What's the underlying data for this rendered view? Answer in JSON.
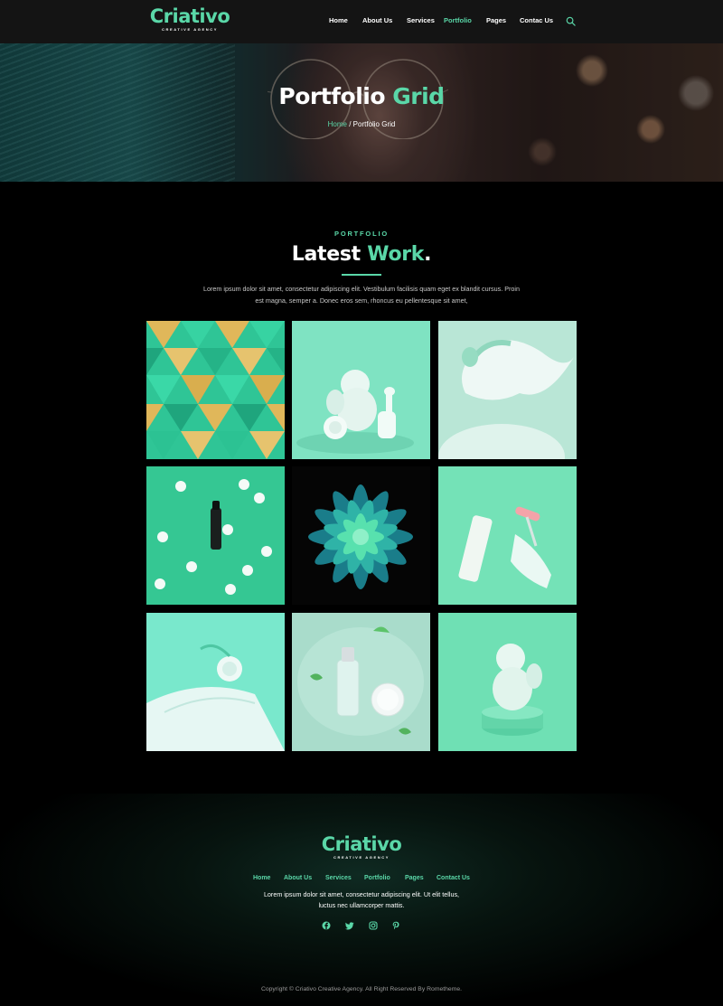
{
  "brand": {
    "name": "Criativo",
    "tagline": "CREATIVE AGENCY",
    "accent_color": "#5ad7a8"
  },
  "nav": {
    "items": [
      {
        "label": "Home",
        "active": false
      },
      {
        "label": "About Us",
        "active": false
      },
      {
        "label": "Services",
        "active": false
      },
      {
        "label": "Portfolio",
        "active": true
      },
      {
        "label": "Pages",
        "active": false
      },
      {
        "label": "Contac Us",
        "active": false
      }
    ],
    "search_icon": "search-icon"
  },
  "hero": {
    "title_main": "Portfolio",
    "title_accent": "Grid",
    "breadcrumb_home": "Home",
    "breadcrumb_sep": " / ",
    "breadcrumb_current": "Portfolio Grid"
  },
  "portfolio": {
    "eyebrow": "PORTFOLIO",
    "title_main": "Latest",
    "title_accent": "Work",
    "title_dot": ".",
    "description": "Lorem ipsum dolor sit amet, consectetur adipiscing elit. Vestibulum facilisis quam eget ex blandit cursus. Proin est magna, semper a. Donec eros sem, rhoncus eu pellentesque sit amet,"
  },
  "footer": {
    "brand_name": "Criativo",
    "brand_tagline": "CREATIVE AGENCY",
    "links": [
      "Home",
      "About Us",
      "Services",
      "Portfolio",
      "Pages",
      "Contact Us"
    ],
    "description": "Lorem ipsum dolor sit amet, consectetur adipiscing elit. Ut elit tellus, luctus nec ullamcorper mattis.",
    "social_icons": [
      "facebook-icon",
      "twitter-icon",
      "instagram-icon",
      "pinterest-icon"
    ],
    "copyright": "Copyright © Criativo Creative Agency. All Right Reserved By Rometheme."
  }
}
